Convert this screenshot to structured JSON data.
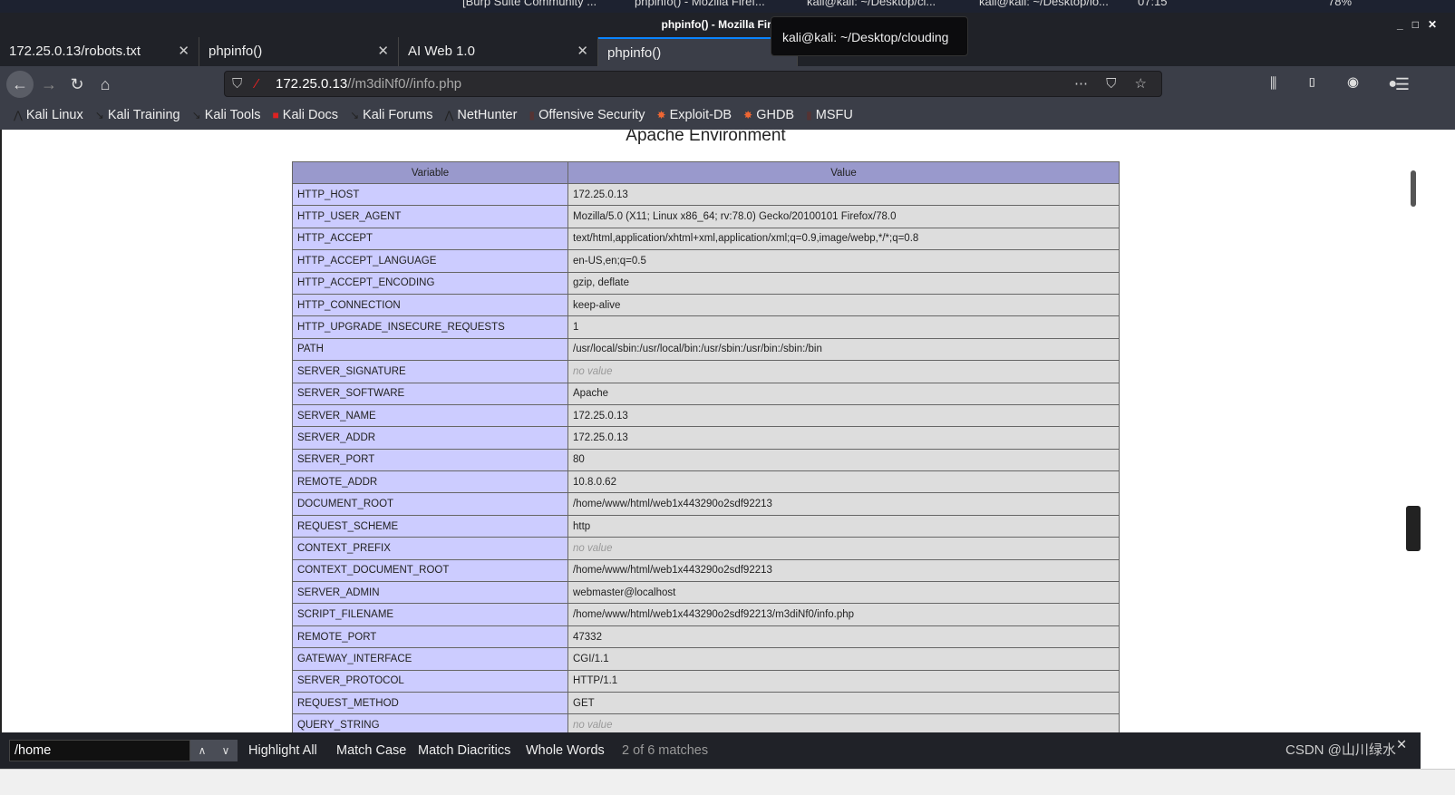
{
  "taskbar": {
    "items": [
      "[Burp Suite Community ...",
      "phpinfo() - Mozilla Firef...",
      "kali@kali: ~/Desktop/cl...",
      "kali@kali: ~/Desktop/lo...",
      "07:15",
      "78%"
    ]
  },
  "window": {
    "title": "phpinfo() - Mozilla Firefox"
  },
  "tabs": [
    {
      "label": "172.25.0.13/robots.txt"
    },
    {
      "label": "phpinfo()"
    },
    {
      "label": "AI Web 1.0"
    },
    {
      "label": "phpinfo()",
      "active": true
    }
  ],
  "tooltip": "kali@kali: ~/Desktop/clouding",
  "url": {
    "host": "172.25.0.13",
    "path": "//m3diNf0//info.php"
  },
  "bookmarks": [
    "Kali Linux",
    "Kali Training",
    "Kali Tools",
    "Kali Docs",
    "Kali Forums",
    "NetHunter",
    "Offensive Security",
    "Exploit-DB",
    "GHDB",
    "MSFU"
  ],
  "page": {
    "heading": "Apache Environment",
    "columns": [
      "Variable",
      "Value"
    ],
    "rows": [
      [
        "HTTP_HOST",
        "172.25.0.13"
      ],
      [
        "HTTP_USER_AGENT",
        "Mozilla/5.0 (X11; Linux x86_64; rv:78.0) Gecko/20100101 Firefox/78.0"
      ],
      [
        "HTTP_ACCEPT",
        "text/html,application/xhtml+xml,application/xml;q=0.9,image/webp,*/*;q=0.8"
      ],
      [
        "HTTP_ACCEPT_LANGUAGE",
        "en-US,en;q=0.5"
      ],
      [
        "HTTP_ACCEPT_ENCODING",
        "gzip, deflate"
      ],
      [
        "HTTP_CONNECTION",
        "keep-alive"
      ],
      [
        "HTTP_UPGRADE_INSECURE_REQUESTS",
        "1"
      ],
      [
        "PATH",
        "/usr/local/sbin:/usr/local/bin:/usr/sbin:/usr/bin:/sbin:/bin"
      ],
      [
        "SERVER_SIGNATURE",
        "no value"
      ],
      [
        "SERVER_SOFTWARE",
        "Apache"
      ],
      [
        "SERVER_NAME",
        "172.25.0.13"
      ],
      [
        "SERVER_ADDR",
        "172.25.0.13"
      ],
      [
        "SERVER_PORT",
        "80"
      ],
      [
        "REMOTE_ADDR",
        "10.8.0.62"
      ],
      [
        "DOCUMENT_ROOT",
        "/home/www/html/web1x443290o2sdf92213"
      ],
      [
        "REQUEST_SCHEME",
        "http"
      ],
      [
        "CONTEXT_PREFIX",
        "no value"
      ],
      [
        "CONTEXT_DOCUMENT_ROOT",
        "/home/www/html/web1x443290o2sdf92213"
      ],
      [
        "SERVER_ADMIN",
        "webmaster@localhost"
      ],
      [
        "SCRIPT_FILENAME",
        "/home/www/html/web1x443290o2sdf92213/m3diNf0/info.php"
      ],
      [
        "REMOTE_PORT",
        "47332"
      ],
      [
        "GATEWAY_INTERFACE",
        "CGI/1.1"
      ],
      [
        "SERVER_PROTOCOL",
        "HTTP/1.1"
      ],
      [
        "REQUEST_METHOD",
        "GET"
      ],
      [
        "QUERY_STRING",
        "no value"
      ]
    ]
  },
  "findbar": {
    "query": "/home",
    "highlight_all": "Highlight All",
    "match_case": "Match Case",
    "match_diacritics": "Match Diacritics",
    "whole_words": "Whole Words",
    "count": "2 of 6 matches"
  },
  "watermark": "CSDN @山川绿水"
}
